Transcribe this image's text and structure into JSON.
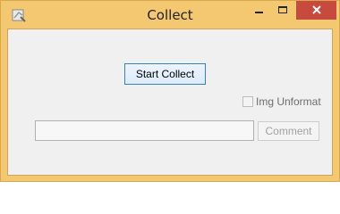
{
  "window": {
    "title": "Collect",
    "icon": "app-icon",
    "controls": {
      "minimize_icon": "minimize-icon",
      "maximize_icon": "maximize-icon",
      "close_icon": "close-icon"
    },
    "frame_color": "#f3c871",
    "close_color": "#c74a3e"
  },
  "content": {
    "start_button_label": "Start Collect",
    "checkbox": {
      "label": "Img Unformat",
      "checked": false,
      "enabled": false
    },
    "comment_input": {
      "value": ""
    },
    "comment_button_label": "Comment"
  }
}
